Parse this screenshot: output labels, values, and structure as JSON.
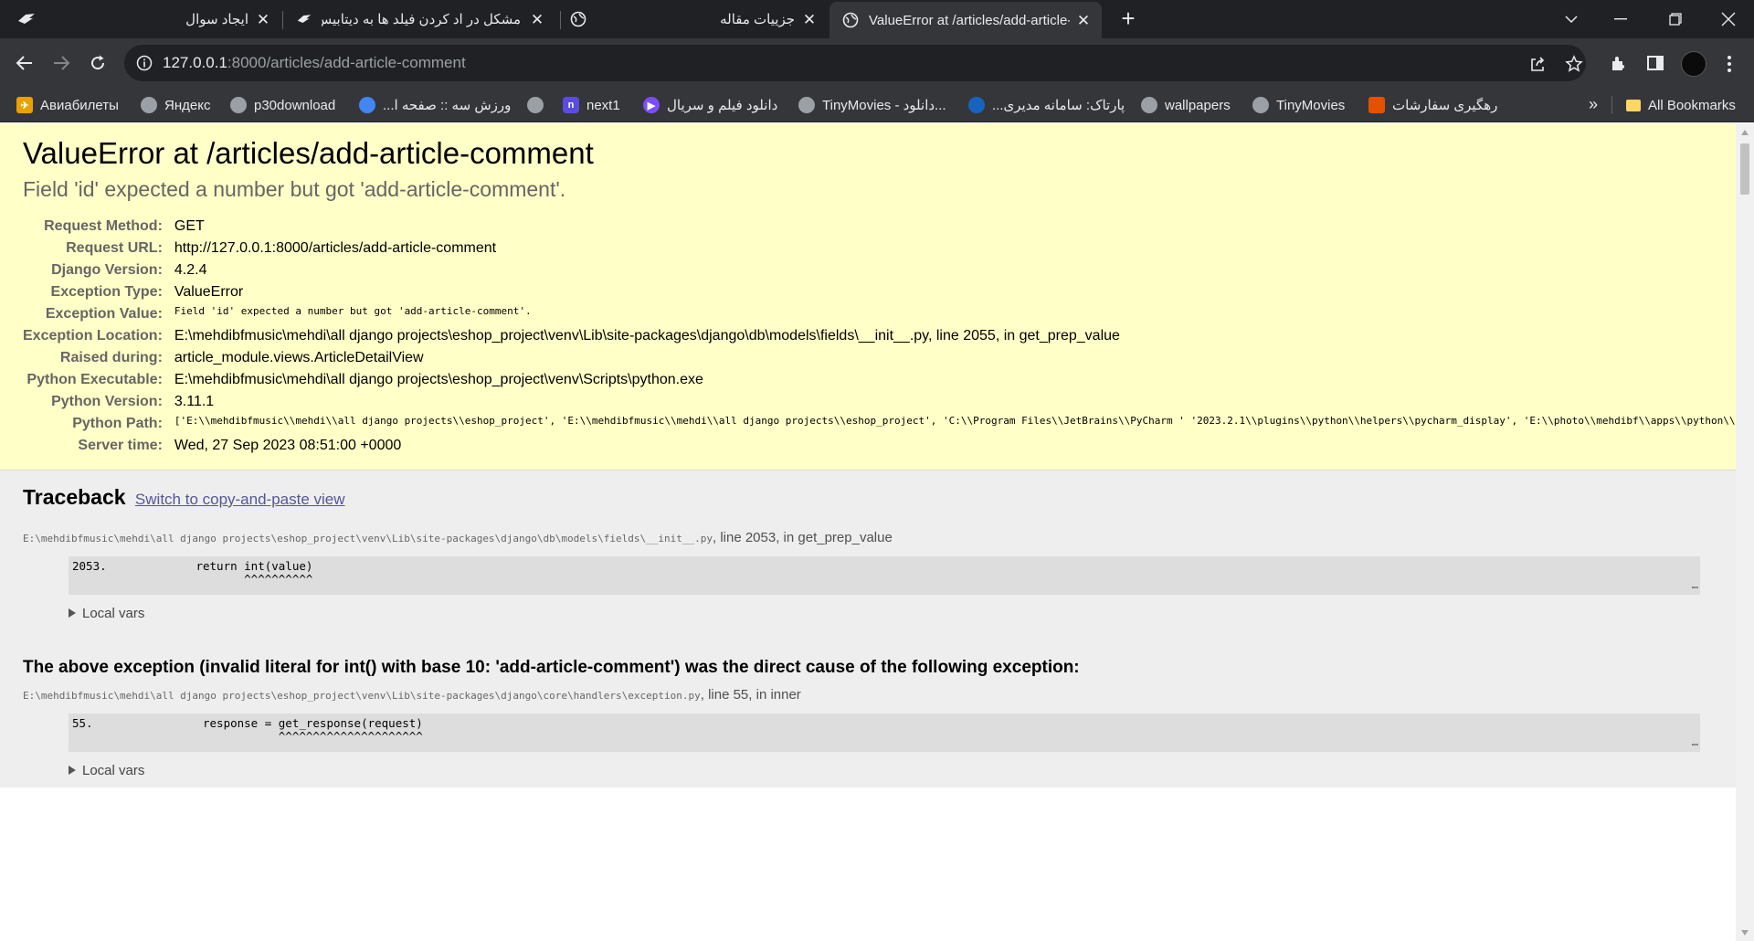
{
  "colors": {
    "tab_strip": "#202124",
    "toolbar": "#35363a",
    "summary_bg": "#ffffc8",
    "traceback_bg": "#eeeeee",
    "link": "#555599"
  },
  "browser": {
    "tabs": [
      {
        "title": "ایجاد سوال",
        "icon": "site-bird-icon",
        "active": false
      },
      {
        "title": "مشکل در اد کردن فیلد ها به دیتابیس",
        "icon": "site-bird-icon",
        "active": false
      },
      {
        "title": "جزییات مقاله",
        "icon": "globe-icon",
        "active": false
      },
      {
        "title": "ValueError at /articles/add-article-comment",
        "icon": "globe-icon",
        "active": true
      }
    ],
    "address": {
      "host": "127.0.0.1",
      "rest": ":8000/articles/add-article-comment"
    },
    "bookmarks": [
      {
        "label": "Авиабилеты",
        "icon": "aviasales-icon",
        "color": "#e8a100"
      },
      {
        "label": "Яндекс",
        "icon": "globe-icon",
        "color": "#9aa0a6"
      },
      {
        "label": "p30download",
        "icon": "globe-icon",
        "color": "#9aa0a6"
      },
      {
        "label": "ورزش سه :: صفحه ا...",
        "icon": "varzesh3-icon",
        "color": "#4285f4"
      },
      {
        "label": "next1",
        "icon": "globe-icon",
        "color": "#9aa0a6"
      },
      {
        "label": "دانلود فیلم و سریال",
        "icon": "next1-icon",
        "color": "#5b4ce0"
      },
      {
        "label": "TinyMovies - دانلود...",
        "icon": "film-reel-icon",
        "color": "#7c4dff"
      },
      {
        "label": "پارتاک: سامانه مدیری...",
        "icon": "film-reel-icon",
        "color": "#9aa0a6"
      },
      {
        "label": "wallpapers",
        "icon": "partak-icon",
        "color": "#1565c0"
      },
      {
        "label": "TinyMovies",
        "icon": "globe-icon",
        "color": "#9aa0a6"
      },
      {
        "label": "رهگیری سفارشات",
        "icon": "film-reel-icon",
        "color": "#9aa0a6"
      }
    ],
    "bookmarks_more": "»",
    "all_bookmarks": "All Bookmarks"
  },
  "error": {
    "title": "ValueError at /articles/add-article-comment",
    "subtitle": "Field 'id' expected a number but got 'add-article-comment'.",
    "meta": [
      {
        "key": "Request Method:",
        "value": "GET",
        "mono": false
      },
      {
        "key": "Request URL:",
        "value": "http://127.0.0.1:8000/articles/add-article-comment",
        "mono": false
      },
      {
        "key": "Django Version:",
        "value": "4.2.4",
        "mono": false
      },
      {
        "key": "Exception Type:",
        "value": "ValueError",
        "mono": false
      },
      {
        "key": "Exception Value:",
        "value": "Field 'id' expected a number but got 'add-article-comment'.",
        "mono": true
      },
      {
        "key": "Exception Location:",
        "value": "E:\\mehdibfmusic\\mehdi\\all django projects\\eshop_project\\venv\\Lib\\site-packages\\django\\db\\models\\fields\\__init__.py, line 2055, in get_prep_value",
        "mono": false
      },
      {
        "key": "Raised during:",
        "value": "article_module.views.ArticleDetailView",
        "mono": false
      },
      {
        "key": "Python Executable:",
        "value": "E:\\mehdibfmusic\\mehdi\\all django projects\\eshop_project\\venv\\Scripts\\python.exe",
        "mono": false
      },
      {
        "key": "Python Version:",
        "value": "3.11.1",
        "mono": false
      }
    ],
    "python_path_key": "Python Path:",
    "python_path": "['E:\\\\mehdibfmusic\\\\mehdi\\\\all django projects\\\\eshop_project',\n 'E:\\\\mehdibfmusic\\\\mehdi\\\\all django projects\\\\eshop_project',\n 'C:\\\\Program Files\\\\JetBrains\\\\PyCharm '\n '2023.2.1\\\\plugins\\\\python\\\\helpers\\\\pycharm_display',\n 'E:\\\\photo\\\\mehdibf\\\\apps\\\\python\\\\python311.zip',\n 'E:\\\\photo\\\\mehdibf\\\\apps\\\\python\\\\DLLs',\n 'E:\\\\photo\\\\mehdibf\\\\apps\\\\python\\\\Lib',\n 'E:\\\\photo\\\\mehdibf\\\\apps\\\\python',\n 'E:\\\\mehdibfmusic\\\\mehdi\\\\all django projects\\\\eshop_project\\\\venv',\n 'E:\\\\mehdibfmusic\\\\mehdi\\\\all django '\n 'projects\\\\eshop_project\\\\venv\\\\Lib\\\\site-packages',\n 'C:\\\\Program Files\\\\JetBrains\\\\PyCharm '\n '2023.2.1\\\\plugins\\\\python\\\\helpers\\\\pycharm_matplotlib_backend']",
    "server_time_key": "Server time:",
    "server_time": "Wed, 27 Sep 2023 08:51:00 +0000"
  },
  "traceback": {
    "heading": "Traceback",
    "switch_link": "Switch to copy-and-paste view",
    "frames": [
      {
        "file": "E:\\mehdibfmusic\\mehdi\\all django projects\\eshop_project\\venv\\Lib\\site-packages\\django\\db\\models\\fields\\__init__.py",
        "where": ", line 2053, in get_prep_value",
        "code": "2053.             return int(value)\n                         ^^^^^^^^^^",
        "local_vars": "Local vars",
        "ellipsis": "…"
      },
      {
        "file": "E:\\mehdibfmusic\\mehdi\\all django projects\\eshop_project\\venv\\Lib\\site-packages\\django\\core\\handlers\\exception.py",
        "where": ", line 55, in inner",
        "code": "55.                response = get_response(request)\n                              ^^^^^^^^^^^^^^^^^^^^^",
        "local_vars": "Local vars",
        "ellipsis": "…"
      }
    ],
    "cause": "The above exception (invalid literal for int() with base 10: 'add-article-comment') was the direct cause of the following exception:"
  }
}
